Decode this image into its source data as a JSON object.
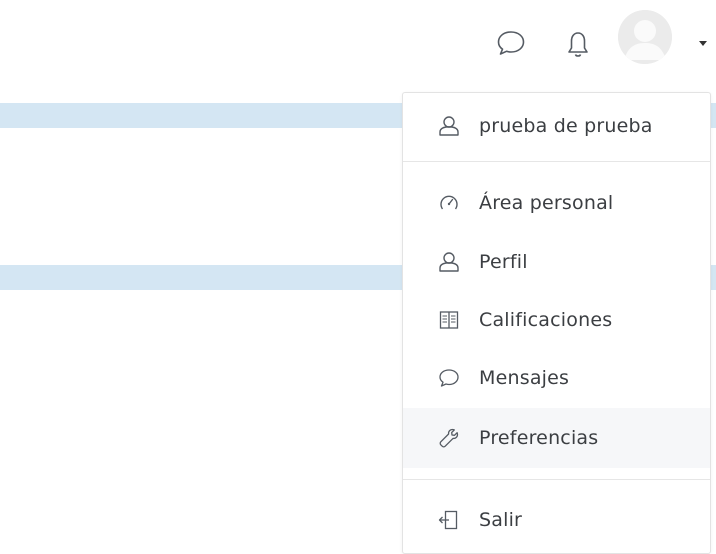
{
  "header": {
    "icons": {
      "messages": "speech-bubble-icon",
      "notifications": "bell-icon",
      "avatar": "user-avatar",
      "caret": "caret-down-icon"
    }
  },
  "user_menu": {
    "user_name": "prueba de prueba",
    "items": [
      {
        "label": "Área personal",
        "icon": "dashboard-icon"
      },
      {
        "label": "Perfil",
        "icon": "user-icon"
      },
      {
        "label": "Calificaciones",
        "icon": "grades-book-icon"
      },
      {
        "label": "Mensajes",
        "icon": "speech-bubble-icon"
      },
      {
        "label": "Preferencias",
        "icon": "wrench-icon"
      }
    ],
    "logout": {
      "label": "Salir",
      "icon": "logout-icon"
    },
    "active_item": "Preferencias"
  },
  "colors": {
    "strip": "#d4e6f3",
    "text": "#3b3e42",
    "icon": "#555b63",
    "hover_bg": "#f6f7f9",
    "border": "#e3e3e3"
  }
}
